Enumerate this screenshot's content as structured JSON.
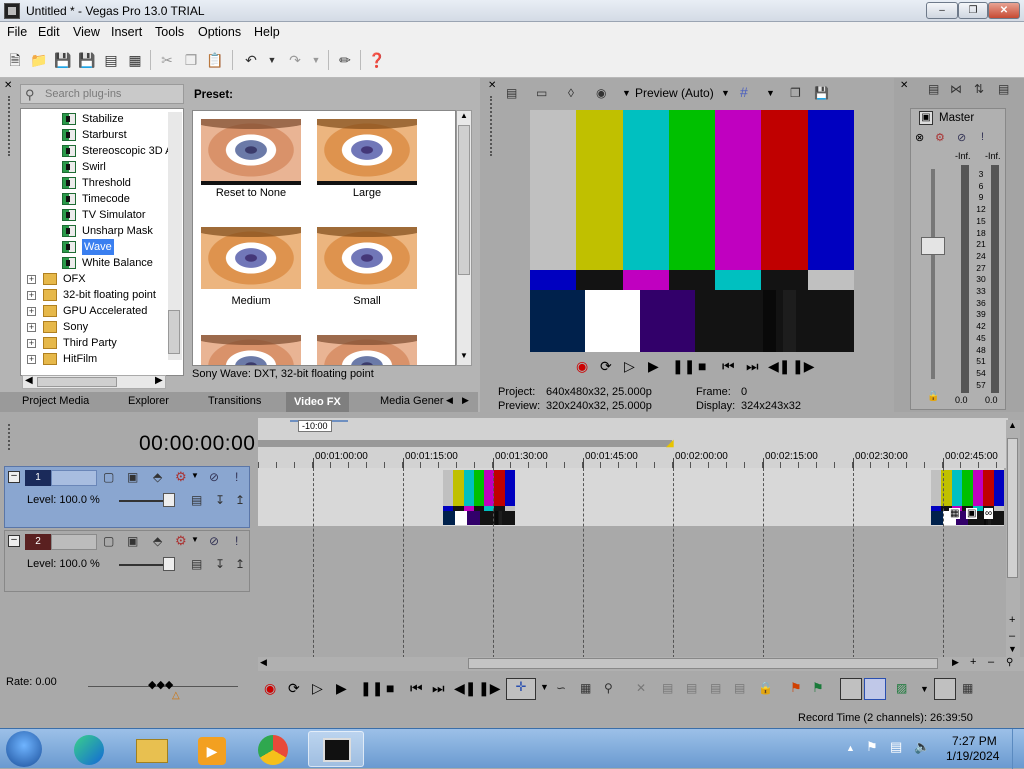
{
  "window": {
    "title": "Untitled * - Vegas Pro 13.0 TRIAL"
  },
  "menu": [
    "File",
    "Edit",
    "View",
    "Insert",
    "Tools",
    "Options",
    "Help"
  ],
  "plugins": {
    "search_placeholder": "Search plug-ins",
    "tree_items": [
      {
        "label": "Stabilize",
        "type": "plugin"
      },
      {
        "label": "Starburst",
        "type": "plugin"
      },
      {
        "label": "Stereoscopic 3D A",
        "type": "plugin"
      },
      {
        "label": "Swirl",
        "type": "plugin"
      },
      {
        "label": "Threshold",
        "type": "plugin"
      },
      {
        "label": "Timecode",
        "type": "plugin"
      },
      {
        "label": "TV Simulator",
        "type": "plugin"
      },
      {
        "label": "Unsharp Mask",
        "type": "plugin"
      },
      {
        "label": "Wave",
        "type": "plugin",
        "selected": true
      },
      {
        "label": "White Balance",
        "type": "plugin"
      },
      {
        "label": "OFX",
        "type": "folder"
      },
      {
        "label": "32-bit floating point",
        "type": "folder"
      },
      {
        "label": "GPU Accelerated",
        "type": "folder"
      },
      {
        "label": "Sony",
        "type": "folder"
      },
      {
        "label": "Third Party",
        "type": "folder"
      },
      {
        "label": "HitFilm",
        "type": "folder"
      }
    ],
    "preset_label": "Preset:",
    "presets": [
      "Reset to None",
      "Large",
      "Medium",
      "Small"
    ],
    "status": "Sony Wave: DXT, 32-bit floating point"
  },
  "tabs": [
    "Project Media",
    "Explorer",
    "Transitions",
    "Video FX",
    "Media Gener"
  ],
  "active_tab": "Video FX",
  "preview": {
    "mode": "Preview (Auto)",
    "project_label": "Project:",
    "project_value": "640x480x32, 25.000p",
    "preview_label": "Preview:",
    "preview_value": "320x240x32, 25.000p",
    "frame_label": "Frame:",
    "frame_value": "0",
    "display_label": "Display:",
    "display_value": "324x243x32"
  },
  "mixer": {
    "title": "Master",
    "left_inf": "-Inf.",
    "right_inf": "-Inf.",
    "scale": [
      "3",
      "6",
      "9",
      "12",
      "15",
      "18",
      "21",
      "24",
      "27",
      "30",
      "33",
      "36",
      "39",
      "42",
      "45",
      "48",
      "51",
      "54",
      "57"
    ],
    "left_val": "0.0",
    "right_val": "0.0"
  },
  "timeline": {
    "time": "00:00:00:00",
    "loop_marker": "-10:00",
    "ruler_labels": [
      "00:01:00:00",
      "00:01:15:00",
      "00:01:30:00",
      "00:01:45:00",
      "00:02:00:00",
      "00:02:15:00",
      "00:02:30:00",
      "00:02:45:00"
    ],
    "tracks": [
      {
        "number": "1",
        "level": "Level: 100.0 %"
      },
      {
        "number": "2",
        "level": "Level: 100.0 %"
      }
    ],
    "rate": "Rate: 0.00",
    "record_time": "Record Time (2 channels): 26:39:50"
  },
  "taskbar": {
    "time": "7:27 PM",
    "date": "1/19/2024"
  },
  "colors": {
    "bars_top": [
      "#c0c0c0",
      "#c0c000",
      "#00c0c0",
      "#00c000",
      "#c000c0",
      "#c00000",
      "#0000c0"
    ],
    "selection": "#3a7ff0",
    "accent": "#6e8fc0"
  }
}
